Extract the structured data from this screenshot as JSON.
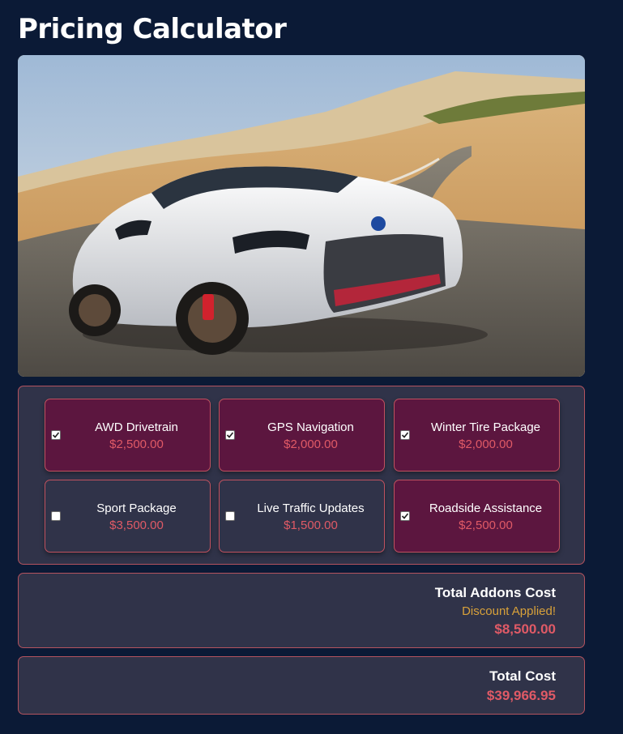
{
  "page": {
    "title": "Pricing Calculator"
  },
  "hero": {
    "icon": "sports-car-photo"
  },
  "addons": [
    {
      "name": "AWD Drivetrain",
      "price": "$2,500.00",
      "selected": true
    },
    {
      "name": "GPS Navigation",
      "price": "$2,000.00",
      "selected": true
    },
    {
      "name": "Winter Tire Package",
      "price": "$2,000.00",
      "selected": true
    },
    {
      "name": "Sport Package",
      "price": "$3,500.00",
      "selected": false
    },
    {
      "name": "Live Traffic Updates",
      "price": "$1,500.00",
      "selected": false
    },
    {
      "name": "Roadside Assistance",
      "price": "$2,500.00",
      "selected": true
    }
  ],
  "summary": {
    "addons_label": "Total Addons Cost",
    "discount_text": "Discount Applied!",
    "addons_total": "$8,500.00",
    "total_label": "Total Cost",
    "total": "$39,966.95"
  },
  "colors": {
    "background": "#0b1a36",
    "panel": "#303349",
    "selected": "#5c163f",
    "border": "#c0525f",
    "price": "#e05a66",
    "discount": "#d8a13a"
  }
}
